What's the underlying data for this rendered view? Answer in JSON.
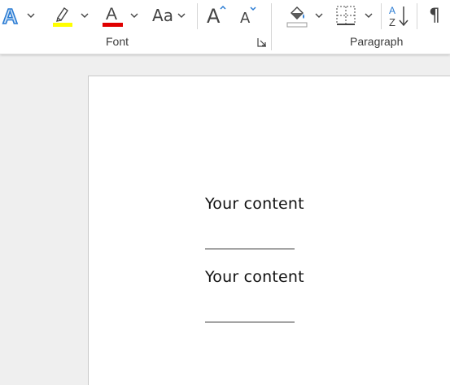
{
  "ribbon": {
    "font_group_label": "Font",
    "paragraph_group_label": "Paragraph",
    "icons": {
      "text_effects": "text-effects-icon",
      "highlight": "highlight-icon",
      "font_color": "font-color-icon",
      "change_case": "change-case-icon",
      "grow_font": "grow-font-icon",
      "shrink_font": "shrink-font-icon",
      "shading": "shading-icon",
      "borders": "borders-icon",
      "sort": "sort-icon",
      "show_marks": "pilcrow-icon"
    },
    "change_case_label": "Aa",
    "grow_font_label": "A",
    "shrink_font_label": "A",
    "font_color_letter": "A",
    "text_effects_letter": "A",
    "pilcrow": "¶",
    "colors": {
      "highlight": "#ffff00",
      "font_color": "#e00000",
      "text_effects": "#2b7cd3",
      "accent": "#2b7cd3"
    }
  },
  "document": {
    "blocks": [
      {
        "text": "Your content"
      },
      {
        "text": "Your content"
      }
    ]
  }
}
